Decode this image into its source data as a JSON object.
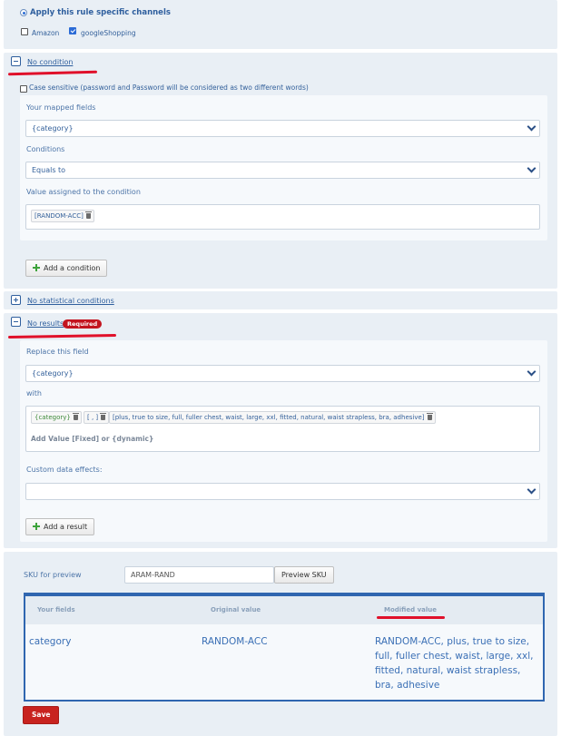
{
  "channels": {
    "apply_label": "Apply this rule specific channels",
    "options": [
      {
        "label": "Amazon",
        "checked": false
      },
      {
        "label": "googleShopping",
        "checked": true
      }
    ]
  },
  "condition": {
    "toggle_label": "No condition",
    "case_sensitive_label": "Case sensitive (password and Password will be considered as two different words)",
    "mapped_fields_label": "Your mapped fields",
    "mapped_field_value": "{category}",
    "conditions_label": "Conditions",
    "condition_value": "Equals to",
    "value_label": "Value assigned to the condition",
    "value_tag": "[RANDOM-ACC]",
    "add_button": "Add a condition"
  },
  "statistical": {
    "toggle_label": "No statistical conditions"
  },
  "results": {
    "toggle_label": "No results",
    "required_badge": "Required",
    "replace_label": "Replace this field",
    "replace_value": "{category}",
    "with_label": "with",
    "with_tags": [
      "{category}",
      "[ , ]",
      "[plus, true to size, full, fuller chest, waist, large, xxl, fitted, natural, waist strapless, bra, adhesive]"
    ],
    "add_value_placeholder": "Add Value [Fixed] or {dynamic}",
    "custom_effects_label": "Custom data effects:",
    "custom_effects_value": "",
    "add_button": "Add a result"
  },
  "preview": {
    "sku_label": "SKU for preview",
    "sku_value": "ARAM-RAND",
    "preview_button": "Preview SKU",
    "columns": [
      "Your fields",
      "Original value",
      "Modified value"
    ],
    "row": {
      "field": "category",
      "original": "RANDOM-ACC",
      "modified": "RANDOM-ACC, plus, true to size, full, fuller chest, waist, large, xxl, fitted, natural, waist strapless, bra, adhesive"
    }
  },
  "save_button": "Save",
  "colors": {
    "accent": "#2f66b0",
    "danger": "#c3141f",
    "underline": "#e0102a",
    "panel": "#e9eff5"
  }
}
